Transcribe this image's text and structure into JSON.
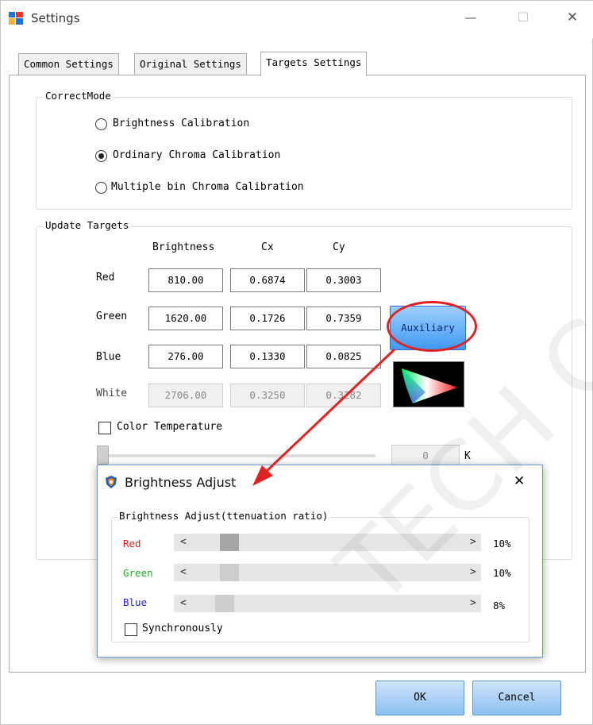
{
  "window": {
    "title": "Settings",
    "minimize": "—",
    "maximize": "☐",
    "close": "✕"
  },
  "tabs": [
    "Common Settings",
    "Original Settings",
    "Targets Settings"
  ],
  "correct_mode": {
    "legend": "CorrectMode",
    "options": [
      "Brightness Calibration",
      "Ordinary Chroma Calibration",
      "Multiple bin Chroma Calibration"
    ],
    "selected": "Ordinary Chroma Calibration"
  },
  "update_targets": {
    "legend": "Update Targets",
    "headers": [
      "Brightness",
      "Cx",
      "Cy"
    ],
    "rows": [
      {
        "label": "Red",
        "brightness": "810.00",
        "cx": "0.6874",
        "cy": "0.3003"
      },
      {
        "label": "Green",
        "brightness": "1620.00",
        "cx": "0.1726",
        "cy": "0.7359"
      },
      {
        "label": "Blue",
        "brightness": "276.00",
        "cx": "0.1330",
        "cy": "0.0825"
      },
      {
        "label": "White",
        "brightness": "2706.00",
        "cx": "0.3250",
        "cy": "0.3282"
      }
    ],
    "auxiliary_button": "Auxiliary",
    "color_temperature_label": "Color Temperature",
    "color_temperature_value": "0",
    "color_temperature_unit": "K"
  },
  "buttons": {
    "ok": "OK",
    "cancel": "Cancel"
  },
  "dialog": {
    "title": "Brightness Adjust",
    "close": "✕",
    "group_legend": "Brightness Adjust(ttenuation ratio)",
    "channels": [
      {
        "label": "Red",
        "value": "10%",
        "color": "#e02020",
        "level": 0.1
      },
      {
        "label": "Green",
        "value": "10%",
        "color": "#1fae1f",
        "level": 0.1
      },
      {
        "label": "Blue",
        "value": "8%",
        "color": "#2020d0",
        "level": 0.08
      }
    ],
    "sync_label": "Synchronously"
  },
  "watermark": "TECH CO",
  "colors": {
    "accent": "#3f9af0",
    "highlight_ring": "#e02222",
    "arrow": "#e02222"
  }
}
